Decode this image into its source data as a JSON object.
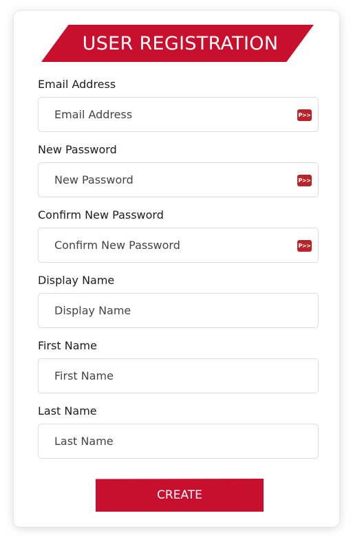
{
  "form": {
    "title": "USER REGISTRATION",
    "fields": [
      {
        "label": "Email Address",
        "placeholder": "Email Address",
        "badge": "P>>"
      },
      {
        "label": "New Password",
        "placeholder": "New Password",
        "badge": "P>>"
      },
      {
        "label": "Confirm New Password",
        "placeholder": "Confirm New Password",
        "badge": "P>>"
      },
      {
        "label": "Display Name",
        "placeholder": "Display Name"
      },
      {
        "label": "First Name",
        "placeholder": "First Name"
      },
      {
        "label": "Last Name",
        "placeholder": "Last Name"
      }
    ],
    "submit_label": "CREATE"
  },
  "colors": {
    "accent": "#c8102e",
    "badge": "#b8242a"
  },
  "icons": {
    "password_manager": "password-manager-icon"
  }
}
